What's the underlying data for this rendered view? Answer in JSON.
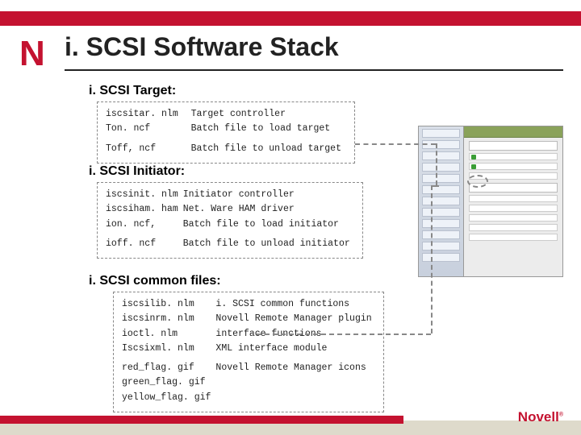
{
  "brand": {
    "n": "N",
    "footer": "Novell"
  },
  "title": "i. SCSI Software Stack",
  "sections": {
    "target": {
      "heading": "i. SCSI Target:"
    },
    "initiator": {
      "heading": "i. SCSI Initiator:"
    },
    "common": {
      "heading": "i. SCSI common files:"
    }
  },
  "target_files": [
    {
      "name": "iscsitar. nlm",
      "desc": "Target controller"
    },
    {
      "name": "Ton. ncf",
      "desc": "Batch file to load target"
    },
    {
      "name": "Toff, ncf",
      "desc": "Batch file to unload target"
    }
  ],
  "initiator_files": [
    {
      "name": "iscsinit. nlm",
      "desc": "Initiator controller"
    },
    {
      "name": "iscsiham. ham",
      "desc": "Net. Ware HAM driver"
    },
    {
      "name": "ion. ncf,",
      "desc": "Batch file to load initiator"
    },
    {
      "name": "ioff. ncf",
      "desc": "Batch file to unload initiator"
    }
  ],
  "common_files": [
    {
      "name": "iscsilib. nlm",
      "desc": "i. SCSI common functions"
    },
    {
      "name": "iscsinrm. nlm",
      "desc": "Novell Remote Manager plugin"
    },
    {
      "name": "ioctl. nlm",
      "desc": "interface functions"
    },
    {
      "name": "Iscsixml. nlm",
      "desc": "XML interface module"
    },
    {
      "name": "red_flag. gif",
      "desc": "Novell Remote Manager icons"
    },
    {
      "name": "green_flag. gif",
      "desc": ""
    },
    {
      "name": "yellow_flag. gif",
      "desc": ""
    }
  ]
}
